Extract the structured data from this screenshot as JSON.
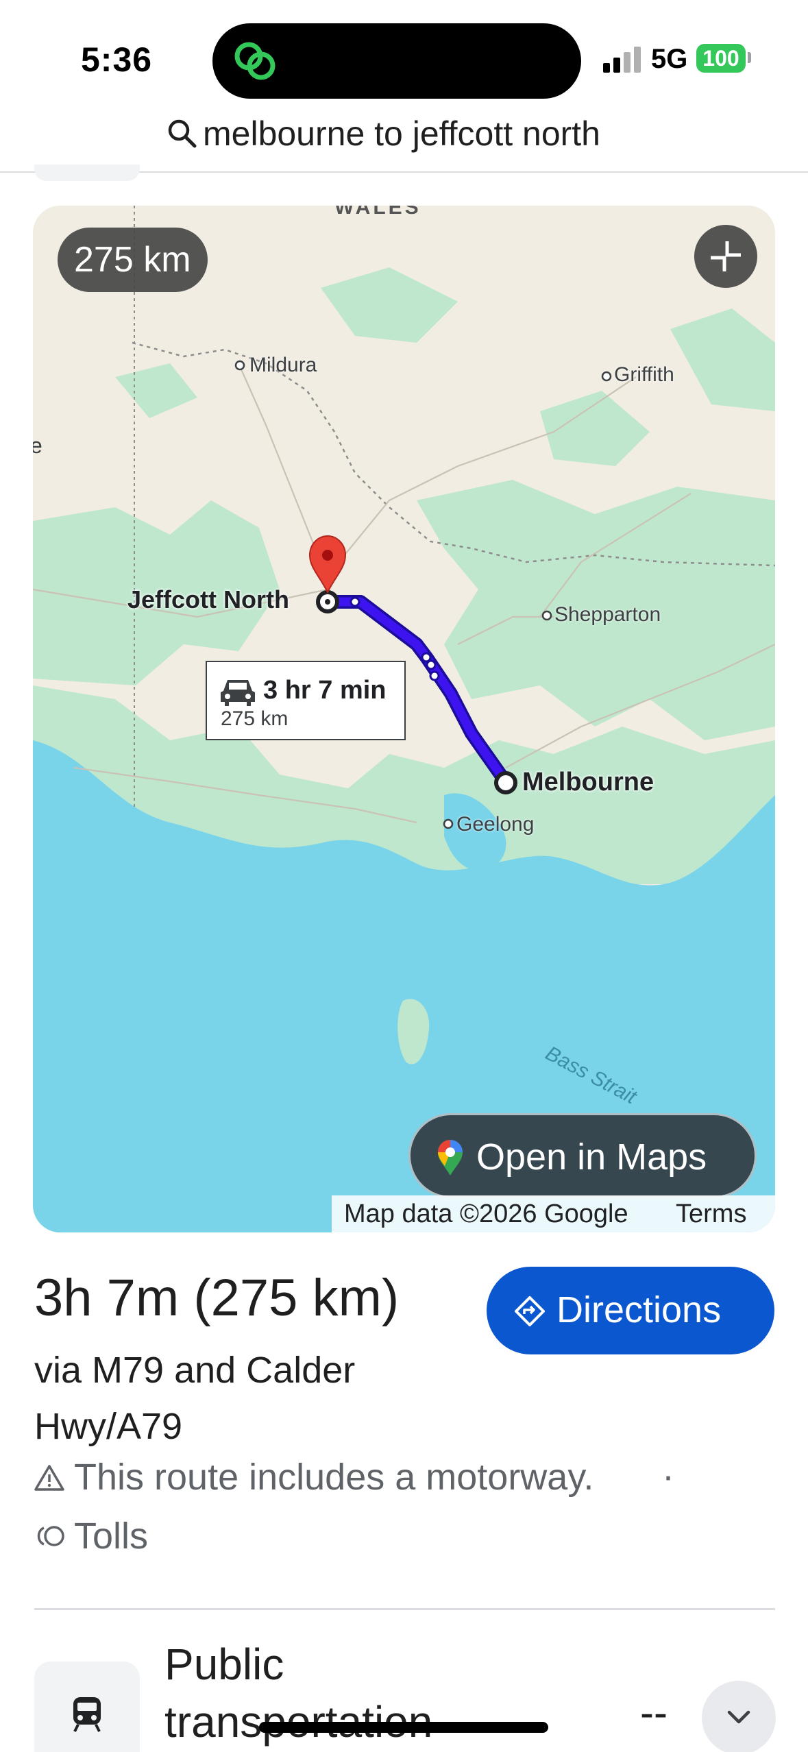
{
  "status_bar": {
    "time": "5:36",
    "network": "5G",
    "battery": "100",
    "island_icon": "linked-rings-icon"
  },
  "search": {
    "query": "melbourne to jeffcott north",
    "icon": "search-icon"
  },
  "map": {
    "distance_chip": "275 km",
    "labels": {
      "mildura": "Mildura",
      "griffith": "Griffith",
      "jeffcott_north": "Jeffcott North",
      "shepparton": "Shepparton",
      "melbourne": "Melbourne",
      "geelong": "Geelong",
      "wales_partial": "WALES",
      "partial_left": "e",
      "sea": "Bass Strait"
    },
    "route_callout": {
      "duration": "3 hr 7 min",
      "distance": "275 km"
    },
    "open_in_maps_label": "Open in Maps",
    "attribution": "Map data ©2026 Google",
    "terms_label": "Terms",
    "colors": {
      "route": "#3d13f0",
      "destination_pin": "#ea4335",
      "water": "#79d4e9",
      "green": "#bfe7ce",
      "land": "#f1ede3"
    }
  },
  "route": {
    "time_distance": "3h 7m (275 km)",
    "via": "via M79 and Calder Hwy/A79",
    "warning": "This route includes a motorway.",
    "separator": "·",
    "tolls": "Tolls",
    "directions_label": "Directions"
  },
  "transit": {
    "title": "Public transportation",
    "value": "--"
  }
}
